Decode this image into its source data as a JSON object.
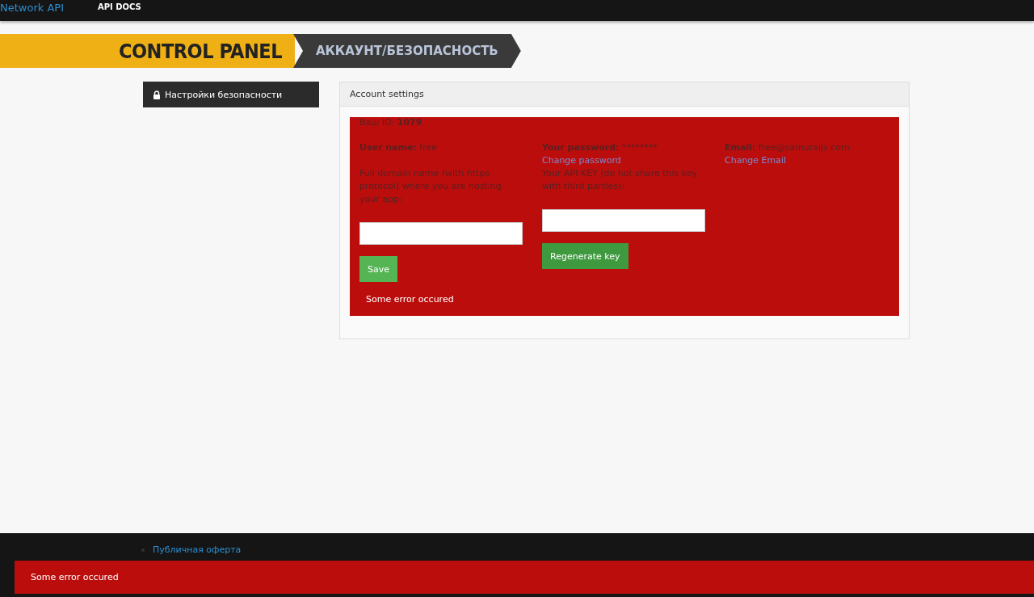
{
  "top_nav": {
    "brand": "Network API",
    "links": [
      {
        "label": "API DOCS"
      }
    ]
  },
  "banner": {
    "title": "CONTROL PANEL",
    "crumb": "АККАУНТ/БЕЗОПАСНОСТЬ"
  },
  "sidebar": {
    "items": [
      {
        "label": "Настройки безопасности",
        "selected": true
      }
    ]
  },
  "panel": {
    "title": "Account settings",
    "id_label": "Ваш ID:",
    "id_value": "1079",
    "columns": [
      {
        "kind": "domain",
        "label": "User name:",
        "value": "free",
        "hint": "Full domain name (with https protocol) where you are hosting your app:",
        "button": "Save",
        "message": "Some error occured"
      },
      {
        "kind": "apikey",
        "label": "Your password:",
        "value": "********",
        "link": "Change password",
        "hint": "Your API KEY (do not share this key with third parties):",
        "button": "Regenerate key"
      },
      {
        "kind": "email",
        "label": "Email:",
        "value": "free@samuraijs.com",
        "link": "Change Email"
      }
    ]
  },
  "footer": {
    "links": [
      {
        "label": "Публичная оферта"
      }
    ]
  },
  "toast": {
    "message": "Some error occured"
  }
}
